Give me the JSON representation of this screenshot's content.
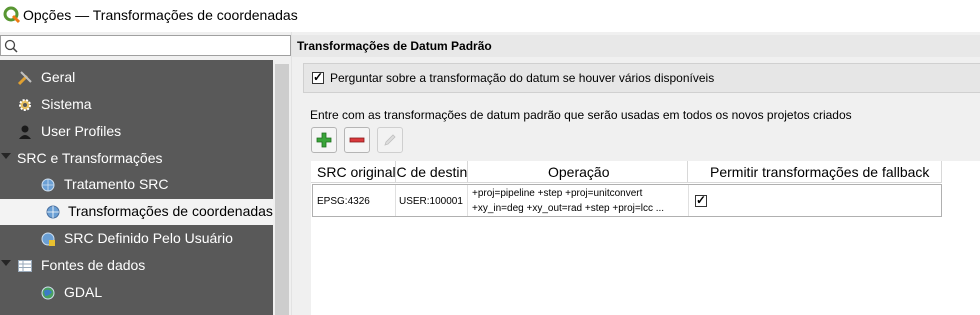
{
  "window": {
    "title": "Opções — Transformações de coordenadas"
  },
  "search": {
    "placeholder": ""
  },
  "sidebar": {
    "items": [
      {
        "label": "Geral",
        "icon": "wrench-icon"
      },
      {
        "label": "Sistema",
        "icon": "gear-icon"
      },
      {
        "label": "User Profiles",
        "icon": "user-icon"
      },
      {
        "label": "SRC e Transformações",
        "icon": ""
      },
      {
        "label": "Tratamento SRC",
        "icon": "globe-icon"
      },
      {
        "label": "Transformações de coordenadas",
        "icon": "globe-icon"
      },
      {
        "label": "SRC Definido Pelo Usuário",
        "icon": "globe-edit-icon"
      },
      {
        "label": "Fontes de dados",
        "icon": "table-icon"
      },
      {
        "label": "GDAL",
        "icon": "globe-icon"
      }
    ]
  },
  "main": {
    "section_title": "Transformações de Datum Padrão",
    "ask_checkbox": {
      "label": "Perguntar sobre a transformação do datum se houver vários disponíveis",
      "checked": true
    },
    "hint": "Entre com as transformações de datum padrão que serão usadas em todos os novos projetos criados",
    "toolbar": {
      "add": "add-icon",
      "remove": "remove-icon",
      "edit": "edit-icon"
    },
    "table": {
      "headers": [
        "SRC original",
        "SRC de destino",
        "Operação",
        "Permitir transformações de fallback"
      ],
      "rows": [
        {
          "source": "EPSG:4326",
          "dest": "USER:100001",
          "operation_line1": "+proj=pipeline +step +proj=unitconvert",
          "operation_line2": "+xy_in=deg +xy_out=rad +step +proj=lcc ...",
          "fallback": true
        }
      ]
    }
  },
  "colors": {
    "sidebar_bg": "#595959",
    "selected_bg": "#f3f3f3",
    "add_green": "#3aa53a",
    "remove_red": "#d9393c"
  }
}
